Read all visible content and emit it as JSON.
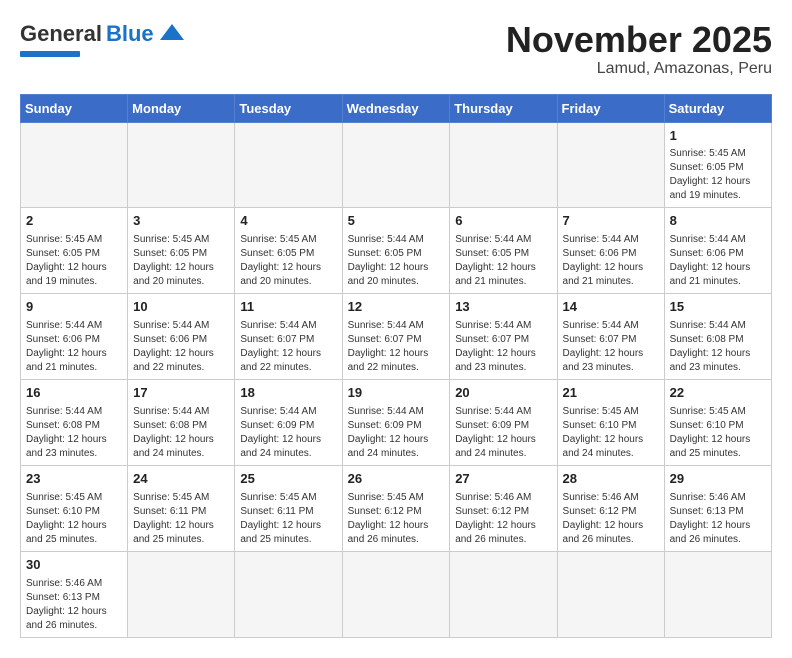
{
  "logo": {
    "general": "General",
    "blue": "Blue"
  },
  "title": "November 2025",
  "subtitle": "Lamud, Amazonas, Peru",
  "weekdays": [
    "Sunday",
    "Monday",
    "Tuesday",
    "Wednesday",
    "Thursday",
    "Friday",
    "Saturday"
  ],
  "weeks": [
    [
      {
        "day": "",
        "info": ""
      },
      {
        "day": "",
        "info": ""
      },
      {
        "day": "",
        "info": ""
      },
      {
        "day": "",
        "info": ""
      },
      {
        "day": "",
        "info": ""
      },
      {
        "day": "",
        "info": ""
      },
      {
        "day": "1",
        "info": "Sunrise: 5:45 AM\nSunset: 6:05 PM\nDaylight: 12 hours\nand 19 minutes."
      }
    ],
    [
      {
        "day": "2",
        "info": "Sunrise: 5:45 AM\nSunset: 6:05 PM\nDaylight: 12 hours\nand 19 minutes."
      },
      {
        "day": "3",
        "info": "Sunrise: 5:45 AM\nSunset: 6:05 PM\nDaylight: 12 hours\nand 20 minutes."
      },
      {
        "day": "4",
        "info": "Sunrise: 5:45 AM\nSunset: 6:05 PM\nDaylight: 12 hours\nand 20 minutes."
      },
      {
        "day": "5",
        "info": "Sunrise: 5:44 AM\nSunset: 6:05 PM\nDaylight: 12 hours\nand 20 minutes."
      },
      {
        "day": "6",
        "info": "Sunrise: 5:44 AM\nSunset: 6:05 PM\nDaylight: 12 hours\nand 21 minutes."
      },
      {
        "day": "7",
        "info": "Sunrise: 5:44 AM\nSunset: 6:06 PM\nDaylight: 12 hours\nand 21 minutes."
      },
      {
        "day": "8",
        "info": "Sunrise: 5:44 AM\nSunset: 6:06 PM\nDaylight: 12 hours\nand 21 minutes."
      }
    ],
    [
      {
        "day": "9",
        "info": "Sunrise: 5:44 AM\nSunset: 6:06 PM\nDaylight: 12 hours\nand 21 minutes."
      },
      {
        "day": "10",
        "info": "Sunrise: 5:44 AM\nSunset: 6:06 PM\nDaylight: 12 hours\nand 22 minutes."
      },
      {
        "day": "11",
        "info": "Sunrise: 5:44 AM\nSunset: 6:07 PM\nDaylight: 12 hours\nand 22 minutes."
      },
      {
        "day": "12",
        "info": "Sunrise: 5:44 AM\nSunset: 6:07 PM\nDaylight: 12 hours\nand 22 minutes."
      },
      {
        "day": "13",
        "info": "Sunrise: 5:44 AM\nSunset: 6:07 PM\nDaylight: 12 hours\nand 23 minutes."
      },
      {
        "day": "14",
        "info": "Sunrise: 5:44 AM\nSunset: 6:07 PM\nDaylight: 12 hours\nand 23 minutes."
      },
      {
        "day": "15",
        "info": "Sunrise: 5:44 AM\nSunset: 6:08 PM\nDaylight: 12 hours\nand 23 minutes."
      }
    ],
    [
      {
        "day": "16",
        "info": "Sunrise: 5:44 AM\nSunset: 6:08 PM\nDaylight: 12 hours\nand 23 minutes."
      },
      {
        "day": "17",
        "info": "Sunrise: 5:44 AM\nSunset: 6:08 PM\nDaylight: 12 hours\nand 24 minutes."
      },
      {
        "day": "18",
        "info": "Sunrise: 5:44 AM\nSunset: 6:09 PM\nDaylight: 12 hours\nand 24 minutes."
      },
      {
        "day": "19",
        "info": "Sunrise: 5:44 AM\nSunset: 6:09 PM\nDaylight: 12 hours\nand 24 minutes."
      },
      {
        "day": "20",
        "info": "Sunrise: 5:44 AM\nSunset: 6:09 PM\nDaylight: 12 hours\nand 24 minutes."
      },
      {
        "day": "21",
        "info": "Sunrise: 5:45 AM\nSunset: 6:10 PM\nDaylight: 12 hours\nand 24 minutes."
      },
      {
        "day": "22",
        "info": "Sunrise: 5:45 AM\nSunset: 6:10 PM\nDaylight: 12 hours\nand 25 minutes."
      }
    ],
    [
      {
        "day": "23",
        "info": "Sunrise: 5:45 AM\nSunset: 6:10 PM\nDaylight: 12 hours\nand 25 minutes."
      },
      {
        "day": "24",
        "info": "Sunrise: 5:45 AM\nSunset: 6:11 PM\nDaylight: 12 hours\nand 25 minutes."
      },
      {
        "day": "25",
        "info": "Sunrise: 5:45 AM\nSunset: 6:11 PM\nDaylight: 12 hours\nand 25 minutes."
      },
      {
        "day": "26",
        "info": "Sunrise: 5:45 AM\nSunset: 6:12 PM\nDaylight: 12 hours\nand 26 minutes."
      },
      {
        "day": "27",
        "info": "Sunrise: 5:46 AM\nSunset: 6:12 PM\nDaylight: 12 hours\nand 26 minutes."
      },
      {
        "day": "28",
        "info": "Sunrise: 5:46 AM\nSunset: 6:12 PM\nDaylight: 12 hours\nand 26 minutes."
      },
      {
        "day": "29",
        "info": "Sunrise: 5:46 AM\nSunset: 6:13 PM\nDaylight: 12 hours\nand 26 minutes."
      }
    ],
    [
      {
        "day": "30",
        "info": "Sunrise: 5:46 AM\nSunset: 6:13 PM\nDaylight: 12 hours\nand 26 minutes."
      },
      {
        "day": "",
        "info": ""
      },
      {
        "day": "",
        "info": ""
      },
      {
        "day": "",
        "info": ""
      },
      {
        "day": "",
        "info": ""
      },
      {
        "day": "",
        "info": ""
      },
      {
        "day": "",
        "info": ""
      }
    ]
  ]
}
